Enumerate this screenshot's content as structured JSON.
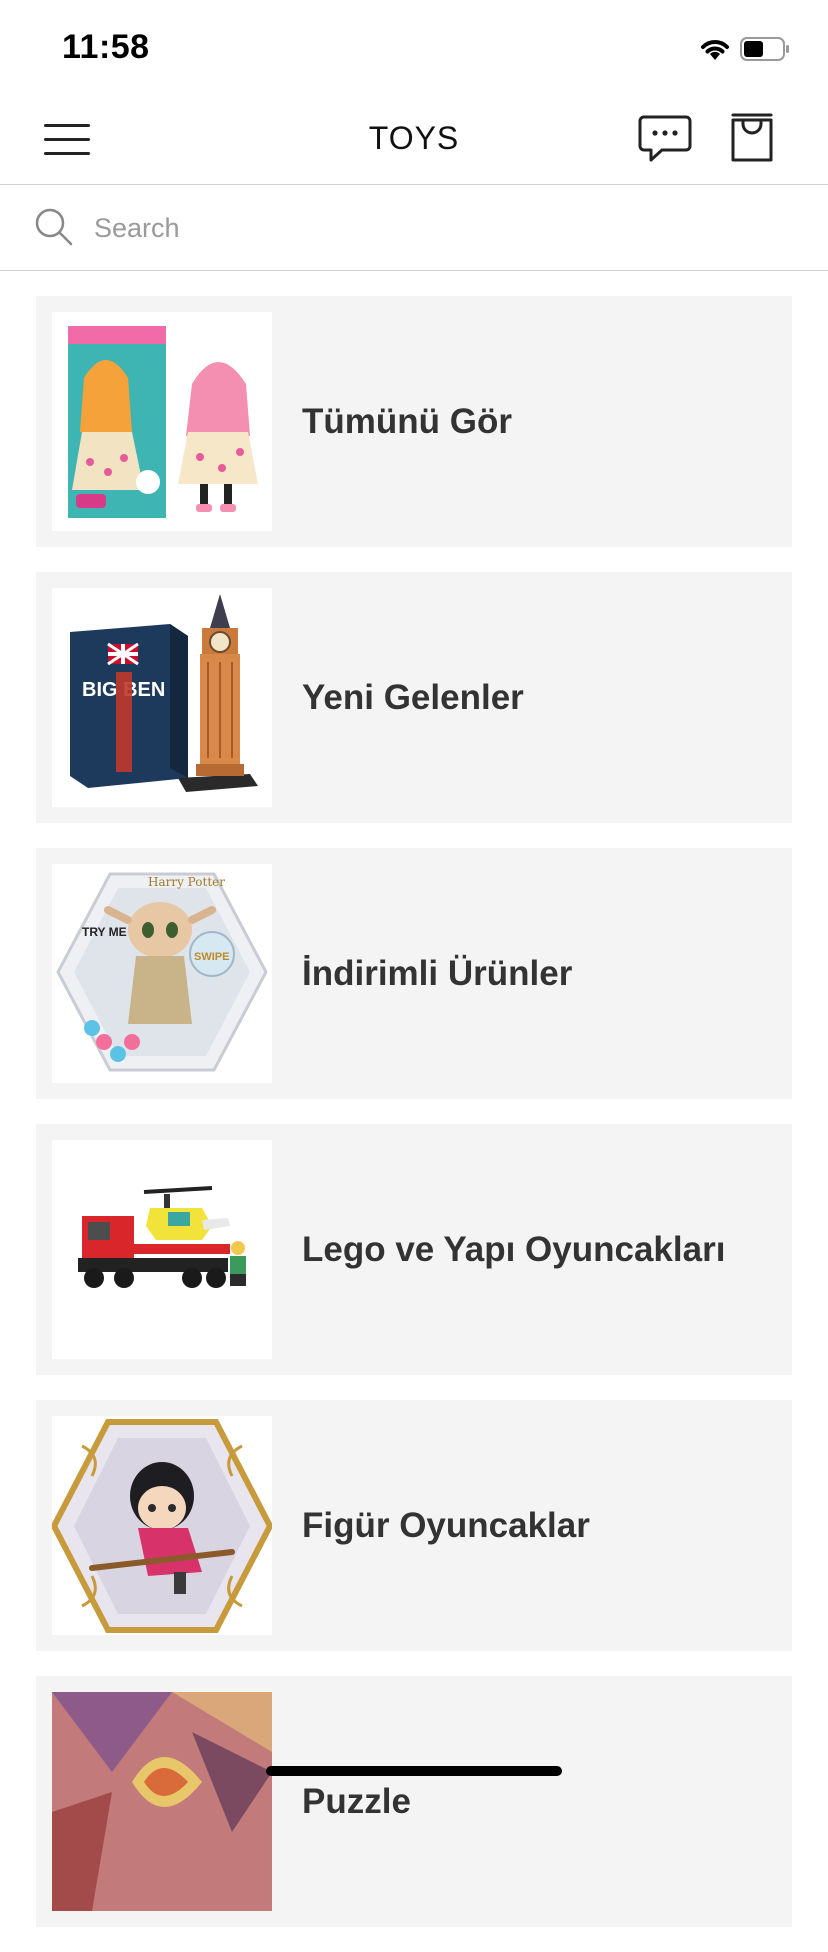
{
  "status_bar": {
    "time": "11:58"
  },
  "nav": {
    "title": "TOYS"
  },
  "search": {
    "placeholder": "Search",
    "value": ""
  },
  "categories": [
    {
      "label": "Tümünü Gör",
      "image": "fashion-doll-box"
    },
    {
      "label": "Yeni Gelenler",
      "image": "big-ben-puzzle"
    },
    {
      "label": "İndirimli Ürünler",
      "image": "wow-pods-figure"
    },
    {
      "label": "Lego ve Yapı Oyuncakları",
      "image": "lego-truck-helicopter"
    },
    {
      "label": "Figür Oyuncaklar",
      "image": "hexagon-figure"
    },
    {
      "label": "Puzzle",
      "image": "puzzle-art"
    }
  ],
  "colors": {
    "card_background": "#f4f4f4",
    "label_text": "#333333",
    "divider": "#d0d0d0"
  },
  "icons": [
    "menu-icon",
    "chat-icon",
    "shopping-bag-icon",
    "search-icon",
    "wifi-icon",
    "battery-icon"
  ]
}
